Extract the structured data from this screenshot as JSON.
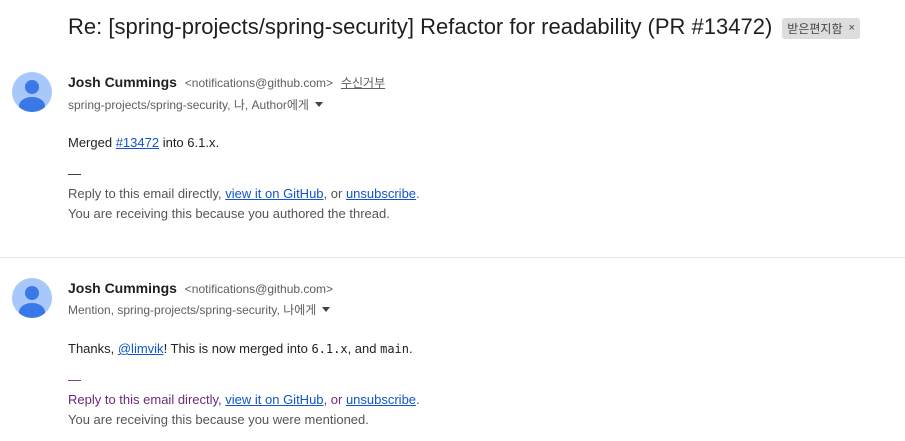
{
  "subject": {
    "text": "Re: [spring-projects/spring-security] Refactor for readability (PR #13472)",
    "label": "받은편지함",
    "label_remove": "×"
  },
  "messages": [
    {
      "sender_name": "Josh Cummings",
      "sender_email": "<notifications@github.com>",
      "unsubscribe": "수신거부",
      "recipients": "spring-projects/spring-security, 나, Author에게",
      "body": {
        "prefix": "Merged ",
        "link": "#13472",
        "suffix": " into 6.1.x."
      },
      "dash": "—",
      "footer": {
        "reply_prefix": "Reply to this email directly, ",
        "view_link": "view it on GitHub",
        "or": ", or ",
        "unsub_link": "unsubscribe",
        "period": ".",
        "reason": "You are receiving this because you authored the thread."
      }
    },
    {
      "sender_name": "Josh Cummings",
      "sender_email": "<notifications@github.com>",
      "recipients": "Mention, spring-projects/spring-security, 나에게",
      "body": {
        "prefix": "Thanks, ",
        "mention": "@limvik",
        "middle": "! This is now merged into ",
        "code1": "6.1.x",
        "and": ", and ",
        "code2": "main",
        "end": "."
      },
      "dash": "—",
      "footer": {
        "reply_prefix": "Reply to this email directly, ",
        "view_link": "view it on GitHub",
        "or": ", or ",
        "unsub_link": "unsubscribe",
        "period": ".",
        "reason": "You are receiving this because you were mentioned."
      }
    }
  ],
  "colors": {
    "link": "#1155cc",
    "avatar_bg": "#a8c7fa",
    "avatar_fg": "#3b78e7",
    "purple_text": "#6a2b7a"
  }
}
